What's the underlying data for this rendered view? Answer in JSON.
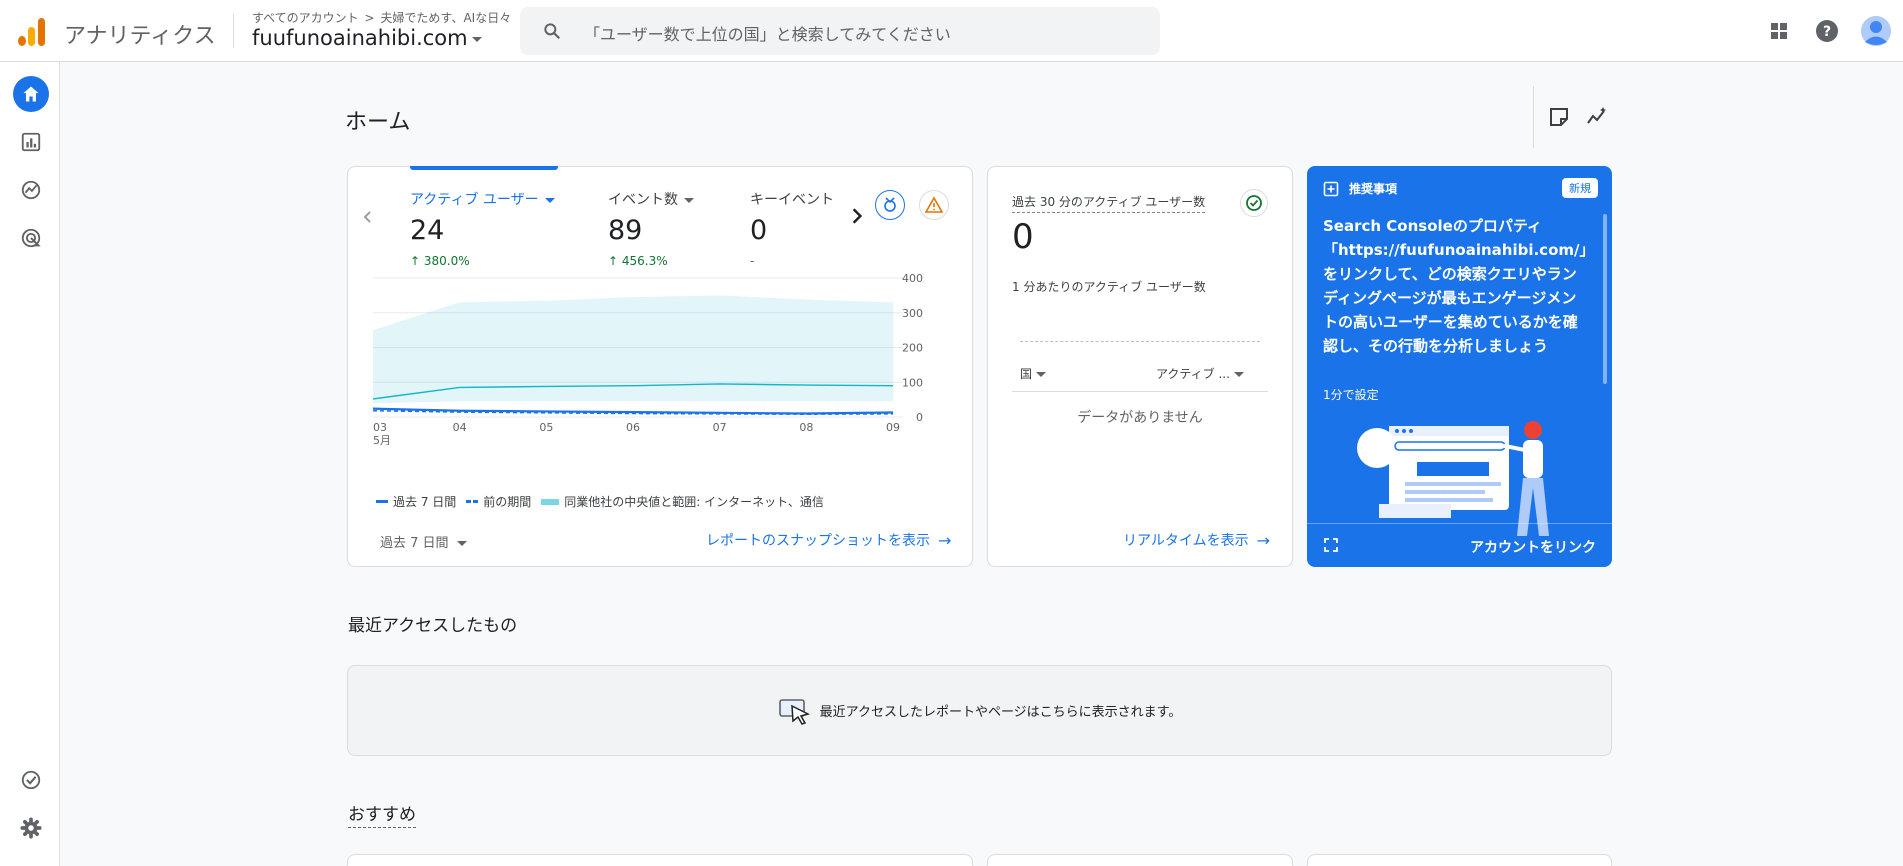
{
  "app": {
    "name": "アナリティクス",
    "breadcrumb": {
      "root": "すべてのアカウント",
      "separator": ">",
      "account": "夫婦でためす、AIな日々"
    },
    "property": "fuufunoainahibi.com"
  },
  "search": {
    "placeholder": "「ユーザー数で上位の国」と検索してみてください"
  },
  "colors": {
    "brand_blue": "#1a73e8",
    "positive_green": "#137333",
    "warning_orange": "#e37400",
    "logo_orange": "#f9ab00",
    "logo_dark_orange": "#e37400"
  },
  "topbar_icons": [
    "apps-icon",
    "help-icon",
    "account-avatar-icon"
  ],
  "leftnav": [
    {
      "name": "home",
      "icon": "home-icon",
      "active": true
    },
    {
      "name": "reports",
      "icon": "bar-chart-icon",
      "active": false
    },
    {
      "name": "explore",
      "icon": "explore-icon",
      "active": false
    },
    {
      "name": "advertising",
      "icon": "target-icon",
      "active": false
    },
    {
      "name": "admin-check",
      "icon": "check-circle-icon",
      "active": false
    },
    {
      "name": "settings",
      "icon": "gear-icon",
      "active": false
    }
  ],
  "page": {
    "title": "ホーム"
  },
  "overview": {
    "metrics": [
      {
        "label": "アクティブ ユーザー",
        "value": "24",
        "change": "380.0%",
        "selected": true
      },
      {
        "label": "イベント数",
        "value": "89",
        "change": "456.3%",
        "selected": false
      },
      {
        "label": "キーイベント",
        "value": "0",
        "change": "-",
        "selected": false
      }
    ],
    "legend": {
      "current": "過去 7 日間",
      "previous": "前の期間",
      "benchmark": "同業他社の中央値と範囲: インターネット、通信"
    },
    "period_selector": "過去 7 日間",
    "snapshot_link": "レポートのスナップショットを表示"
  },
  "chart_data": {
    "type": "line",
    "x": [
      "03",
      "04",
      "05",
      "06",
      "07",
      "08",
      "09"
    ],
    "x_sublabel": "5月",
    "ylim": [
      0,
      400
    ],
    "y_ticks": [
      0,
      100,
      200,
      300,
      400
    ],
    "grid": true,
    "legend_position": "bottom-left",
    "series": [
      {
        "name": "過去 7 日間",
        "style": "solid",
        "color": "#1a73e8",
        "values": [
          24,
          18,
          16,
          14,
          12,
          10,
          13
        ]
      },
      {
        "name": "前の期間",
        "style": "dashed",
        "color": "#1a73e8",
        "values": [
          18,
          14,
          12,
          10,
          9,
          8,
          9
        ]
      },
      {
        "name": "同業他社の中央値と範囲: インターネット、通信",
        "style": "band",
        "color": "#12b5cb",
        "median": [
          52,
          85,
          88,
          90,
          95,
          92,
          90
        ],
        "upper": [
          250,
          330,
          335,
          345,
          350,
          338,
          330
        ],
        "lower": [
          40,
          45,
          45,
          45,
          45,
          45,
          45
        ]
      }
    ]
  },
  "realtime": {
    "title": "過去 30 分のアクティブ ユーザー数",
    "value": "0",
    "subtitle": "1 分あたりのアクティブ ユーザー数",
    "col_country": "国",
    "col_users": "アクティブ ...",
    "empty": "データがありません",
    "link": "リアルタイムを表示"
  },
  "recommendation": {
    "header": "推奨事項",
    "badge": "新規",
    "text": "Search Consoleのプロパティ「https://fuufunoainahibi.com/」をリンクして、どの検索クエリやランディングページが最もエンゲージメントの高いユーザーを集めているかを確認し、その行動を分析しましょう",
    "time": "1分で設定",
    "action": "アカウントをリンク"
  },
  "recent": {
    "title": "最近アクセスしたもの",
    "empty_message": "最近アクセスしたレポートやページはこちらに表示されます。"
  },
  "suggested": {
    "title": "おすすめ"
  }
}
